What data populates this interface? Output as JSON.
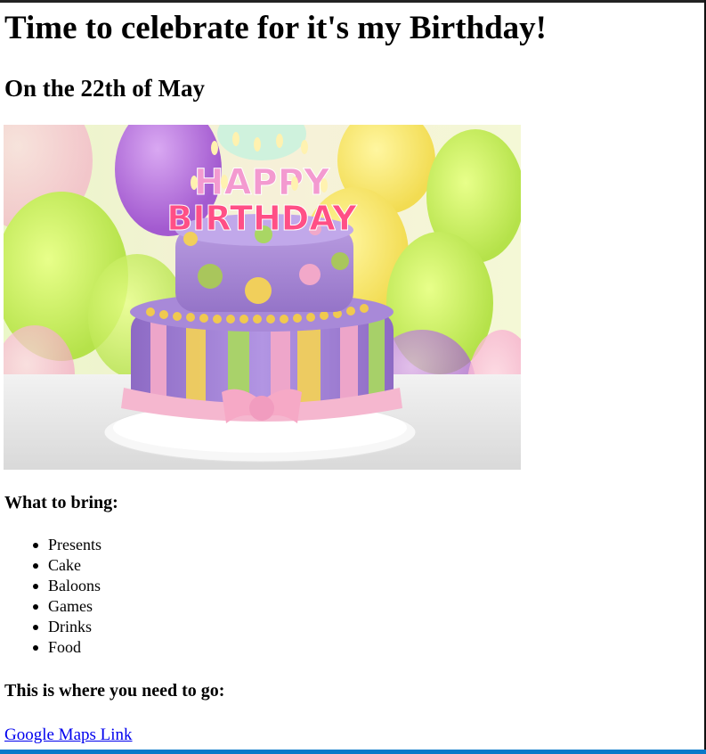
{
  "page": {
    "title": "Time to celebrate for it's my Birthday!",
    "subtitle": "On the 22th of May"
  },
  "image": {
    "candle_letters_top": "HAPPY",
    "candle_letters_bottom": "BIRTHDAY"
  },
  "bring": {
    "heading": "What to bring:",
    "items": [
      "Presents",
      "Cake",
      "Baloons",
      "Games",
      "Drinks",
      "Food"
    ]
  },
  "location": {
    "heading": "This is where you need to go:",
    "link_text": "Google Maps Link"
  },
  "colors": {
    "link": "#0000ee",
    "bottom_bar": "#0a79c9"
  }
}
